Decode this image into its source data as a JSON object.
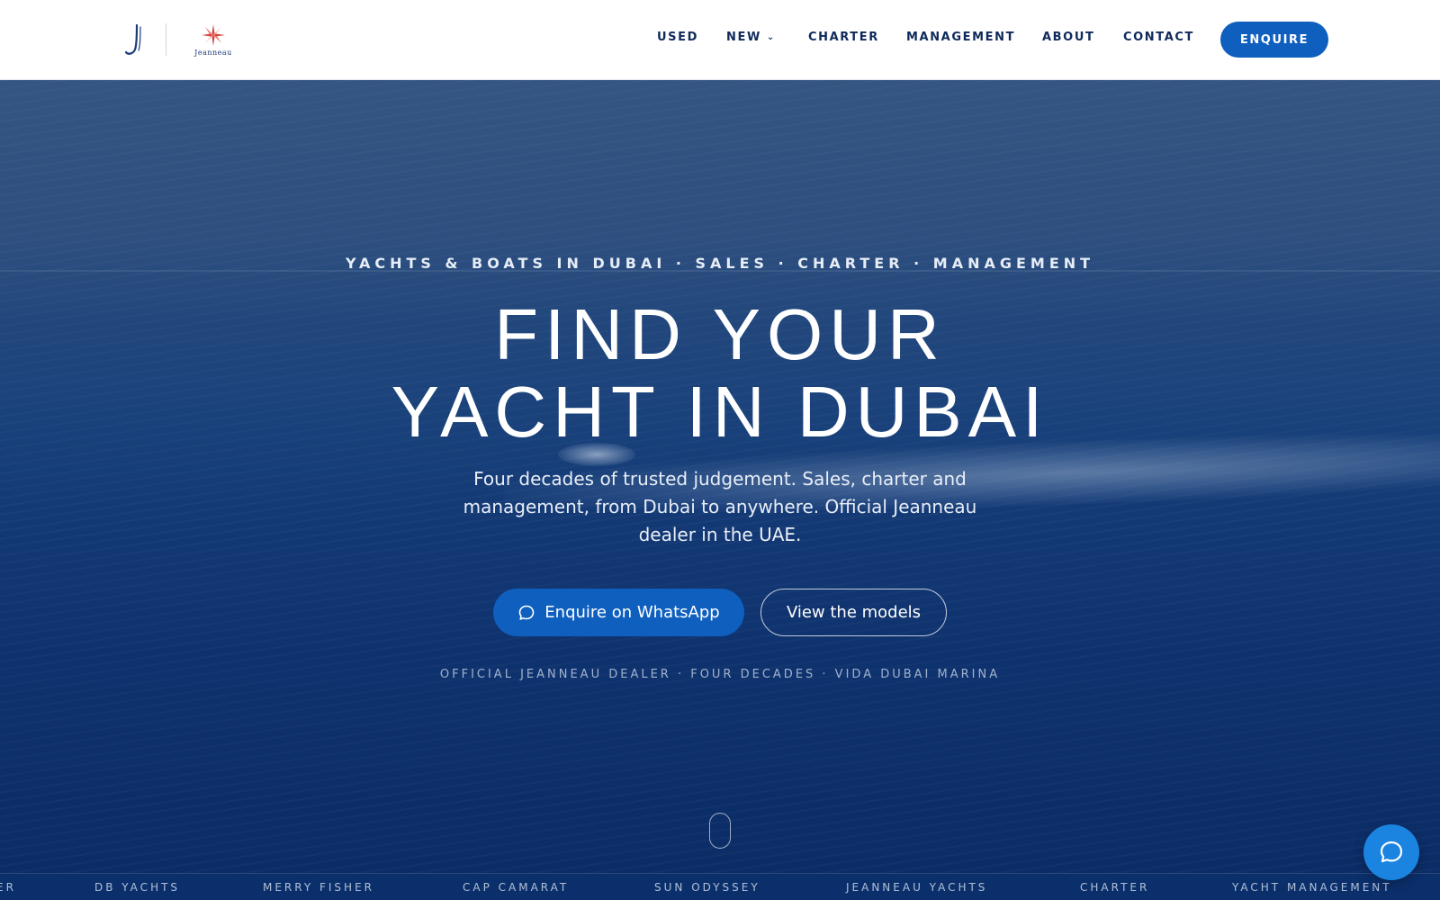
{
  "header": {
    "logo_brand": "Jeanneau",
    "nav": {
      "used": "USED",
      "new": "NEW",
      "charter": "CHARTER",
      "management": "MANAGEMENT",
      "about": "ABOUT",
      "contact": "CONTACT"
    },
    "enquire_label": "ENQUIRE"
  },
  "hero": {
    "eyebrow": "YACHTS & BOATS IN DUBAI · SALES · CHARTER · MANAGEMENT",
    "headline_line1": "FIND YOUR",
    "headline_line2": "YACHT IN DUBAI",
    "subtitle": "Four decades of trusted judgement. Sales, charter and management, from Dubai to anywhere. Official Jeanneau dealer in the UAE.",
    "primary_cta": "Enquire on WhatsApp",
    "secondary_cta": "View the models",
    "trust_line": "OFFICIAL JEANNEAU DEALER · FOUR DECADES · VIDA DUBAI MARINA"
  },
  "ticker": {
    "items": [
      "ER",
      "DB YACHTS",
      "MERRY FISHER",
      "CAP CAMARAT",
      "SUN ODYSSEY",
      "JEANNEAU YACHTS",
      "CHARTER",
      "YACHT MANAGEMENT"
    ]
  },
  "colors": {
    "accent": "#0f5fbf",
    "nav_text": "#0f2a5a",
    "hero_tint": "#0f3372",
    "chat_bubble": "#1a84e0"
  },
  "icons": {
    "logo": "j-monogram-icon",
    "brand": "compass-rose-icon",
    "dropdown": "chevron-down-icon",
    "whatsapp": "chat-bubble-icon",
    "scroll": "scroll-mouse-icon",
    "chat": "chat-bubble-icon"
  }
}
